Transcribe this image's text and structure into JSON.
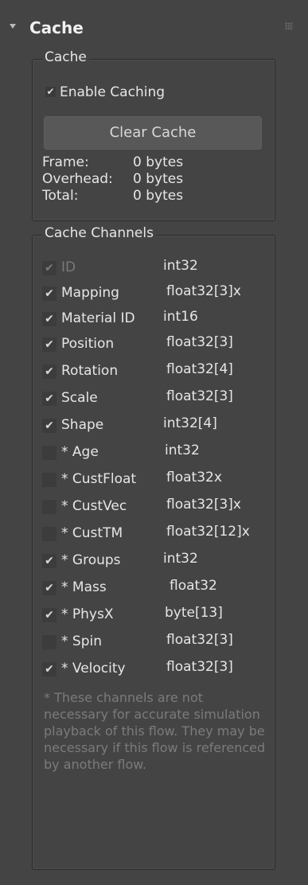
{
  "rollout": {
    "title": "Cache"
  },
  "cache_group": {
    "title": "Cache",
    "enable_caching": {
      "label": "Enable Caching",
      "checked": true
    },
    "clear_button_label": "Clear Cache",
    "stats": [
      {
        "label": "Frame:",
        "value": "0 bytes"
      },
      {
        "label": "Overhead:",
        "value": "0 bytes"
      },
      {
        "label": "Total:",
        "value": "0 bytes"
      }
    ]
  },
  "channels_group": {
    "title": "Cache Channels",
    "channels": [
      {
        "label": "ID",
        "type": "int32",
        "checked": true,
        "disabled": true
      },
      {
        "label": "Mapping",
        "type": "float32[3]x",
        "checked": true,
        "disabled": false
      },
      {
        "label": "Material ID",
        "type": "int16",
        "checked": true,
        "disabled": false
      },
      {
        "label": "Position",
        "type": "float32[3]",
        "checked": true,
        "disabled": false
      },
      {
        "label": "Rotation",
        "type": "float32[4]",
        "checked": true,
        "disabled": false
      },
      {
        "label": "Scale",
        "type": "float32[3]",
        "checked": true,
        "disabled": false
      },
      {
        "label": "Shape",
        "type": "int32[4]",
        "checked": true,
        "disabled": false
      },
      {
        "label": "* Age",
        "type": "int32",
        "checked": false,
        "disabled": false
      },
      {
        "label": "* CustFloat",
        "type": "float32x",
        "checked": false,
        "disabled": false
      },
      {
        "label": "* CustVec",
        "type": "float32[3]x",
        "checked": false,
        "disabled": false
      },
      {
        "label": "* CustTM",
        "type": "float32[12]x",
        "checked": false,
        "disabled": false
      },
      {
        "label": "* Groups",
        "type": "int32",
        "checked": true,
        "disabled": false
      },
      {
        "label": "* Mass",
        "type": "float32",
        "checked": true,
        "disabled": false
      },
      {
        "label": "* PhysX",
        "type": "byte[13]",
        "checked": true,
        "disabled": false
      },
      {
        "label": "* Spin",
        "type": "float32[3]",
        "checked": false,
        "disabled": false
      },
      {
        "label": "* Velocity",
        "type": "float32[3]",
        "checked": true,
        "disabled": false
      }
    ],
    "footnote": "* These channels are not necessary for accurate simulation playback of this flow. They may be necessary if this flow is referenced by another flow."
  },
  "check_glyph": "✔",
  "colors": {
    "background": "#444444",
    "text": "#e6e6e6",
    "muted": "#7b7b7b"
  }
}
